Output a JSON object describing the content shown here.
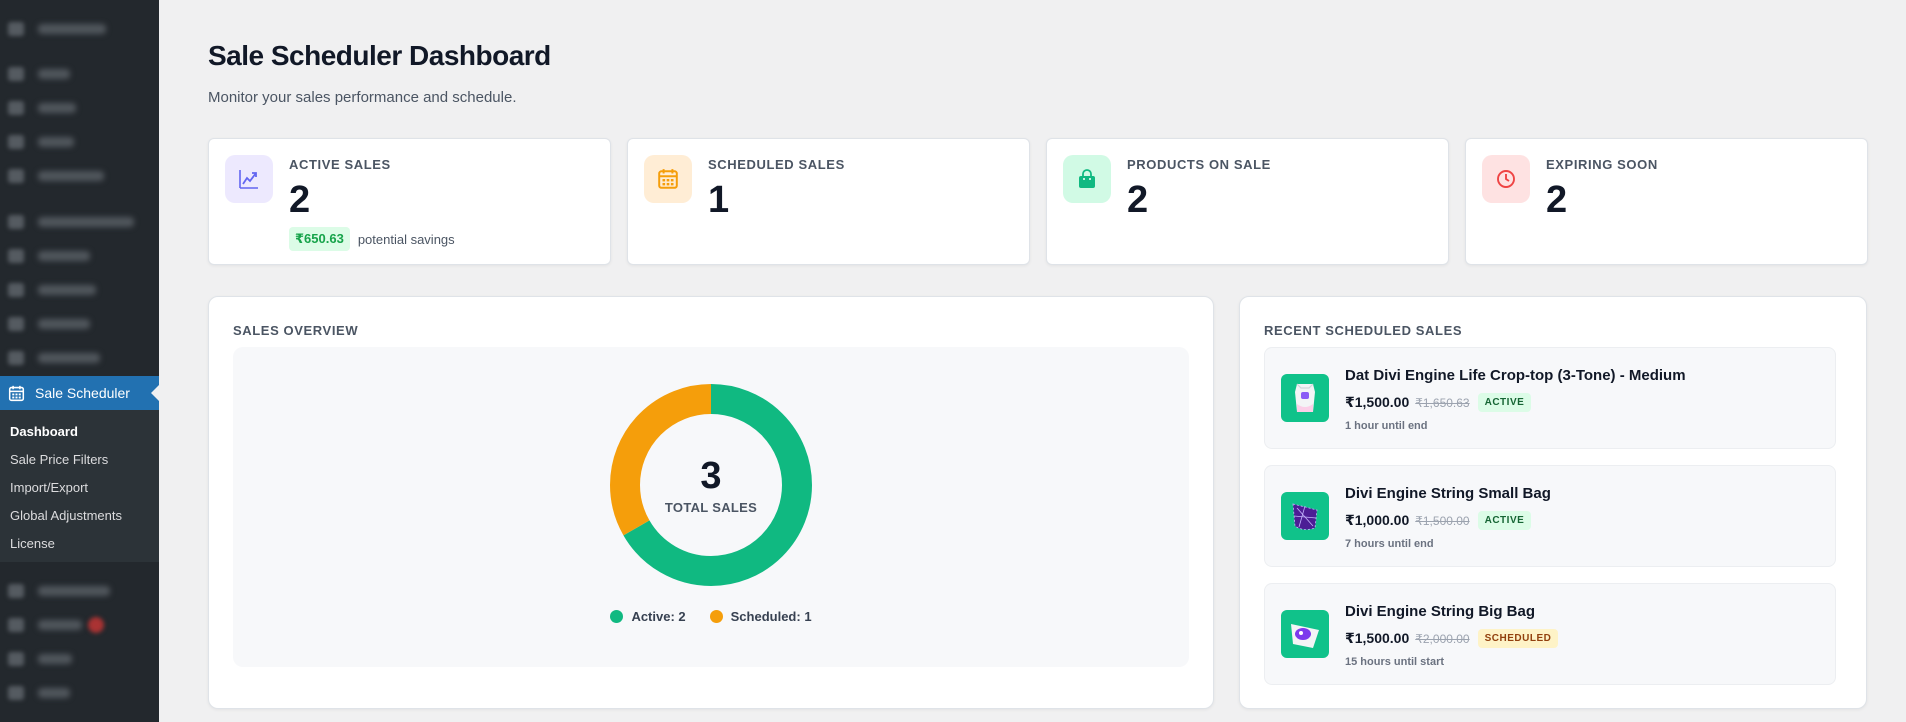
{
  "sidebar": {
    "current_menu": "Sale Scheduler",
    "submenu": [
      "Dashboard",
      "Sale Price Filters",
      "Import/Export",
      "Global Adjustments",
      "License"
    ],
    "active_submenu": "Dashboard",
    "accent_color": "#2271b1"
  },
  "header": {
    "title": "Sale Scheduler Dashboard",
    "subtitle": "Monitor your sales performance and schedule."
  },
  "stats": [
    {
      "label": "ACTIVE SALES",
      "value": "2",
      "icon": "trending-chart-icon",
      "savings_amount": "₹650.63",
      "savings_text": "potential savings"
    },
    {
      "label": "SCHEDULED SALES",
      "value": "1",
      "icon": "calendar-icon"
    },
    {
      "label": "PRODUCTS ON SALE",
      "value": "2",
      "icon": "shopping-bag-icon"
    },
    {
      "label": "EXPIRING SOON",
      "value": "2",
      "icon": "clock-icon"
    }
  ],
  "overview": {
    "title": "SALES OVERVIEW",
    "total": "3",
    "total_label": "TOTAL SALES",
    "legend": [
      "Active: 2",
      "Scheduled: 1"
    ]
  },
  "chart_data": {
    "type": "pie",
    "categories": [
      "Active",
      "Scheduled"
    ],
    "values": [
      2,
      1
    ],
    "colors": [
      "#10b981",
      "#f59e0b"
    ],
    "title": "SALES OVERVIEW",
    "center_value": 3,
    "center_label": "TOTAL SALES",
    "legend_placement": "bottom"
  },
  "recent": {
    "title": "RECENT SCHEDULED SALES",
    "items": [
      {
        "name": "Dat Divi Engine Life Crop-top (3-Tone) - Medium",
        "price": "₹1,500.00",
        "old_price": "₹1,650.63",
        "status": "ACTIVE",
        "timer": "1 hour until end"
      },
      {
        "name": "Divi Engine String Small Bag",
        "price": "₹1,000.00",
        "old_price": "₹1,500.00",
        "status": "ACTIVE",
        "timer": "7 hours until end"
      },
      {
        "name": "Divi Engine String Big Bag",
        "price": "₹1,500.00",
        "old_price": "₹2,000.00",
        "status": "SCHEDULED",
        "timer": "15 hours until start"
      }
    ]
  }
}
